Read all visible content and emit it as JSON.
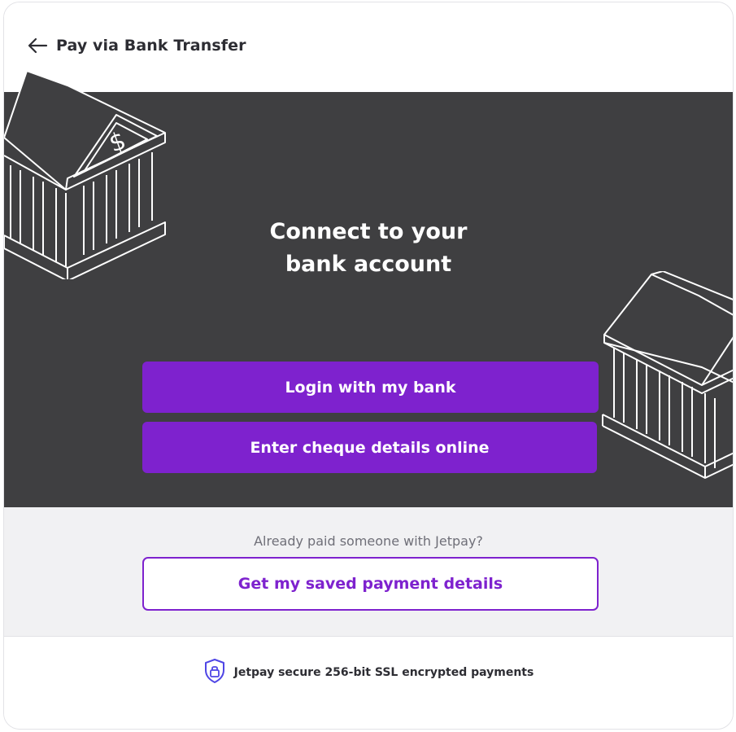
{
  "header": {
    "title": "Pay via Bank Transfer",
    "back_icon": "arrow-left-icon"
  },
  "hero": {
    "title_line1": "Connect to your",
    "title_line2": "bank account",
    "login_button": "Login with my bank",
    "cheque_button": "Enter cheque details online",
    "illustration": "bank-building-icon"
  },
  "saved": {
    "prompt": "Already paid someone with Jetpay?",
    "button": "Get my saved payment details"
  },
  "footer": {
    "secure_text": "Jetpay secure 256-bit SSL encrypted payments",
    "secure_icon": "shield-lock-icon"
  },
  "colors": {
    "accent": "#7e22ce",
    "hero_bg": "#3f3f41",
    "saved_bg": "#f1f1f3",
    "shield": "#4f46e5"
  }
}
